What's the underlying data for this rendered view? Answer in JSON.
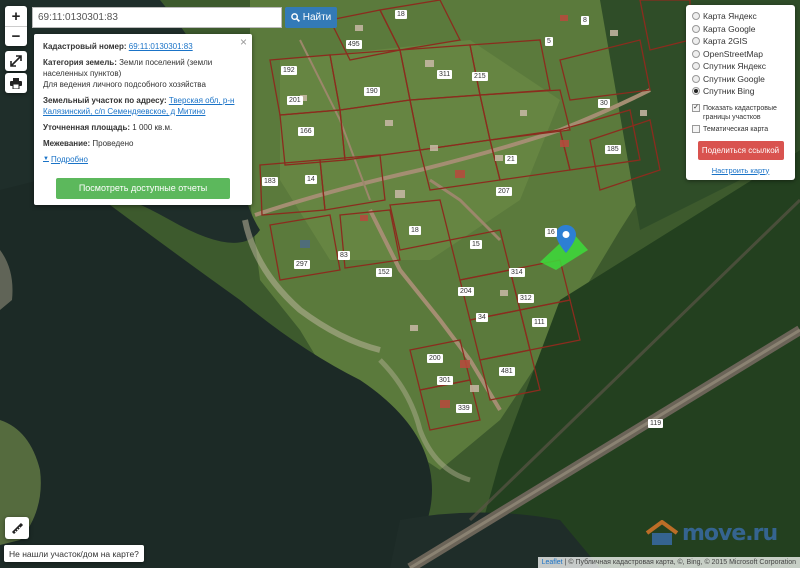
{
  "search": {
    "value": "69:11:0130301:83",
    "button_label": "Найти",
    "button_color": "#337ab7"
  },
  "zoom": {
    "in_label": "+",
    "out_label": "−"
  },
  "popup": {
    "close_label": "×",
    "cadastral_label": "Кадастровый номер:",
    "cadastral_value": "69:11:0130301:83",
    "category_label": "Категория земель:",
    "category_value": "Земли поселений (земли населенных пунктов)",
    "category_use": "Для ведения личного подсобного хозяйства",
    "address_label": "Земельный участок по адресу:",
    "address_value": "Тверская обл, р-н Калязинский, с/п Семендяевское, д Митино",
    "area_label": "Уточненная площадь:",
    "area_value": "1 000 кв.м.",
    "survey_label": "Межевание:",
    "survey_value": "Проведено",
    "more_label": "Подробно",
    "report_button": "Посмотреть доступные отчеты",
    "report_color": "#5cb85c"
  },
  "layers": {
    "options": [
      {
        "label": "Карта Яндекс",
        "selected": false
      },
      {
        "label": "Карта Google",
        "selected": false
      },
      {
        "label": "Карта 2GIS",
        "selected": false
      },
      {
        "label": "OpenStreetMap",
        "selected": false
      },
      {
        "label": "Спутник Яндекс",
        "selected": false
      },
      {
        "label": "Спутник Google",
        "selected": false
      },
      {
        "label": "Спутник Bing",
        "selected": true
      }
    ],
    "show_borders_label": "Показать кадастровые границы участков",
    "show_borders_checked": true,
    "thematic_label": "Тематическая карта",
    "thematic_checked": false,
    "share_button": "Поделиться ссылкой",
    "share_color": "#d9534f",
    "setup_link": "Настроить карту"
  },
  "parcel_labels": [
    "495",
    "192",
    "201",
    "190",
    "311",
    "215",
    "166",
    "30",
    "185",
    "14",
    "21",
    "207",
    "183",
    "18",
    "16",
    "297",
    "83",
    "152",
    "15",
    "314",
    "204",
    "312",
    "34",
    "111",
    "200",
    "301",
    "481",
    "339",
    "119",
    "8",
    "5",
    "18"
  ],
  "not_found_label": "Не нашли участок/дом на карте?",
  "attribution": {
    "leaflet": "Leaflet",
    "text": "| © Публичная кадастровая карта, ©, Bing, © 2015 Microsoft Corporation"
  },
  "watermark": "move.ru",
  "colors": {
    "parcel_border": "#8b2c1e",
    "selected_parcel": "#3ddc3a",
    "marker": "#2d7fd3"
  }
}
